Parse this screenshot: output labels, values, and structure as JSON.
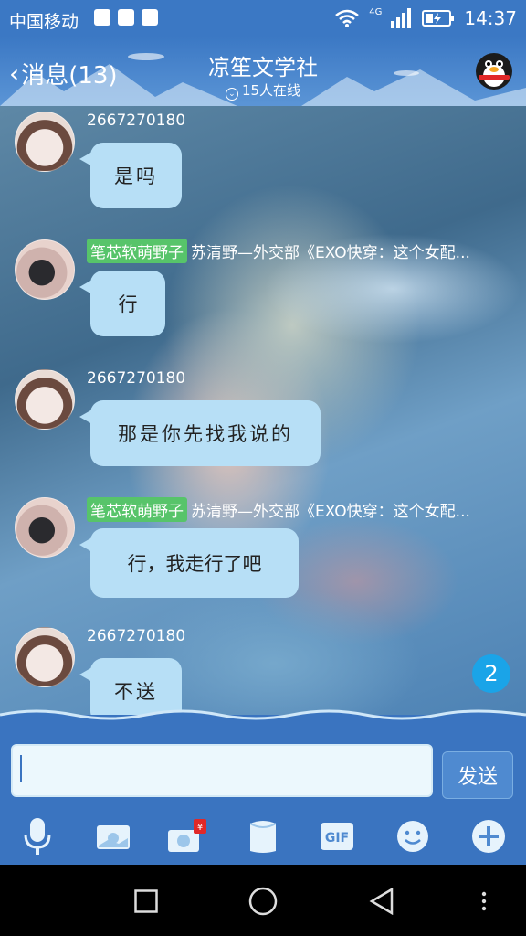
{
  "status_bar": {
    "carrier": "中国移动",
    "network": "4G",
    "time": "14:37"
  },
  "header": {
    "back_label": "消息(13)",
    "title": "凉笙文学社",
    "online": "15人在线"
  },
  "messages": [
    {
      "sender": "2667270180",
      "badge": "",
      "text": "是吗",
      "style": "script"
    },
    {
      "sender": "苏清野—外交部《EXO快穿：这个女配...",
      "badge": "笔芯软萌野子",
      "text": "行",
      "style": "plain"
    },
    {
      "sender": "2667270180",
      "badge": "",
      "text": "那是你先找我说的",
      "style": "script"
    },
    {
      "sender": "苏清野—外交部《EXO快穿：这个女配...",
      "badge": "笔芯软萌野子",
      "text": "行，我走行了吧",
      "style": "plain"
    },
    {
      "sender": "2667270180",
      "badge": "",
      "text": "不送",
      "style": "script"
    }
  ],
  "unread_count": "2",
  "input": {
    "value": "",
    "send_label": "发送"
  },
  "toolbar": {
    "gif_label": "GIF",
    "redpacket_symbol": "¥",
    "items": [
      "microphone-icon",
      "photo-icon",
      "camera-redpacket-icon",
      "wallet-icon",
      "gif-icon",
      "emoji-icon",
      "plus-icon"
    ]
  },
  "colors": {
    "header_blue": "#3b78c4",
    "bubble": "#b7dff6",
    "badge_green": "#57c46a",
    "unread_blue": "#1aa4e8"
  }
}
